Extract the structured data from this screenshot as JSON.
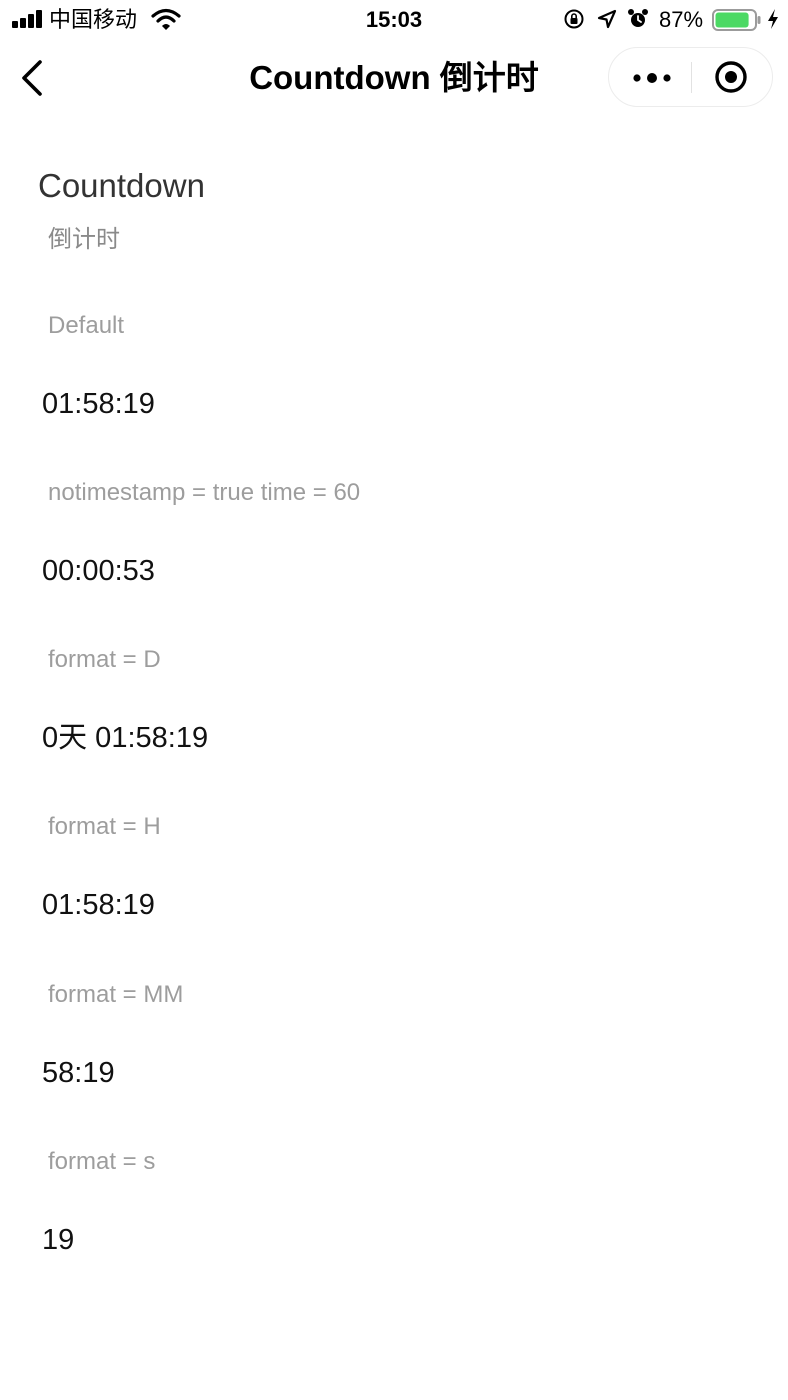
{
  "status_bar": {
    "carrier": "中国移动",
    "time": "15:03",
    "battery": "87%",
    "battery_level": 0.87,
    "icons": [
      "signal-icon",
      "wifi-icon",
      "orientation-lock-icon",
      "location-icon",
      "alarm-icon",
      "battery-icon",
      "charging-icon"
    ]
  },
  "nav": {
    "title": "Countdown 倒计时",
    "icons": [
      "back-chevron-icon",
      "more-dots-icon",
      "target-close-icon"
    ]
  },
  "page": {
    "heading": "Countdown",
    "subheading": "倒计时"
  },
  "demos": [
    {
      "label": "Default",
      "value": "01:58:19"
    },
    {
      "label": "notimestamp = true time = 60",
      "value": "00:00:53"
    },
    {
      "label": "format = D",
      "value": "0天 01:58:19"
    },
    {
      "label": "format = H",
      "value": "01:58:19"
    },
    {
      "label": "format = MM",
      "value": "58:19"
    },
    {
      "label": "format = s",
      "value": "19"
    }
  ],
  "colors": {
    "background": "#ffffff",
    "heading": "#333333",
    "label": "#9d9d9d",
    "value": "#111111",
    "battery_fill": "#4cd964"
  }
}
